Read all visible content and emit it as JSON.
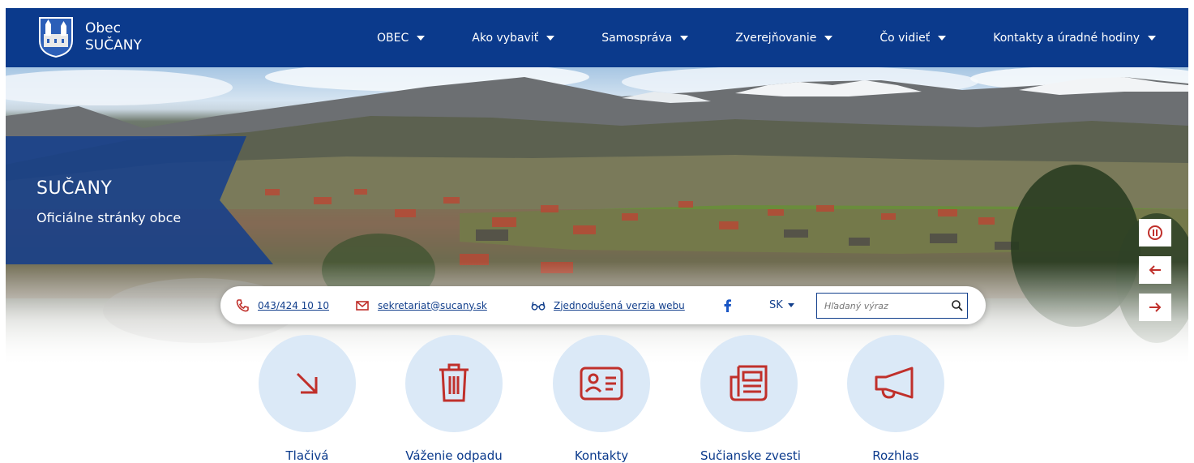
{
  "brand": {
    "line1": "Obec",
    "line2": "SUČANY",
    "crest_icon": "coat-of-arms-icon"
  },
  "nav": {
    "items": [
      {
        "label": "OBEC"
      },
      {
        "label": "Ako vybaviť"
      },
      {
        "label": "Samospráva"
      },
      {
        "label": "Zverejňovanie"
      },
      {
        "label": "Čo vidieť"
      },
      {
        "label": "Kontakty a úradné hodiny"
      }
    ]
  },
  "hero": {
    "title": "SUČANY",
    "subtitle": "Oficiálne stránky obce",
    "controls": [
      {
        "icon": "pause-icon"
      },
      {
        "icon": "arrow-left-icon"
      },
      {
        "icon": "arrow-right-icon"
      }
    ]
  },
  "infobar": {
    "phone": "043/424 10 10",
    "email": "sekretariat@sucany.sk",
    "simplified": "Zjednodušená verzia webu",
    "language": "SK",
    "search_placeholder": "Hľadaný výraz"
  },
  "quick_links": [
    {
      "label": "Tlačivá",
      "icon": "arrow-down-right-icon"
    },
    {
      "label": "Váženie odpadu",
      "icon": "trash-icon"
    },
    {
      "label": "Kontakty",
      "icon": "contact-card-icon"
    },
    {
      "label": "Sučianske zvesti",
      "icon": "newspaper-icon"
    },
    {
      "label": "Rozhlas",
      "icon": "megaphone-icon"
    }
  ],
  "colors": {
    "primary": "#0b3a8c",
    "accent": "#c0302b",
    "tile_bg": "#dbe9f7"
  }
}
